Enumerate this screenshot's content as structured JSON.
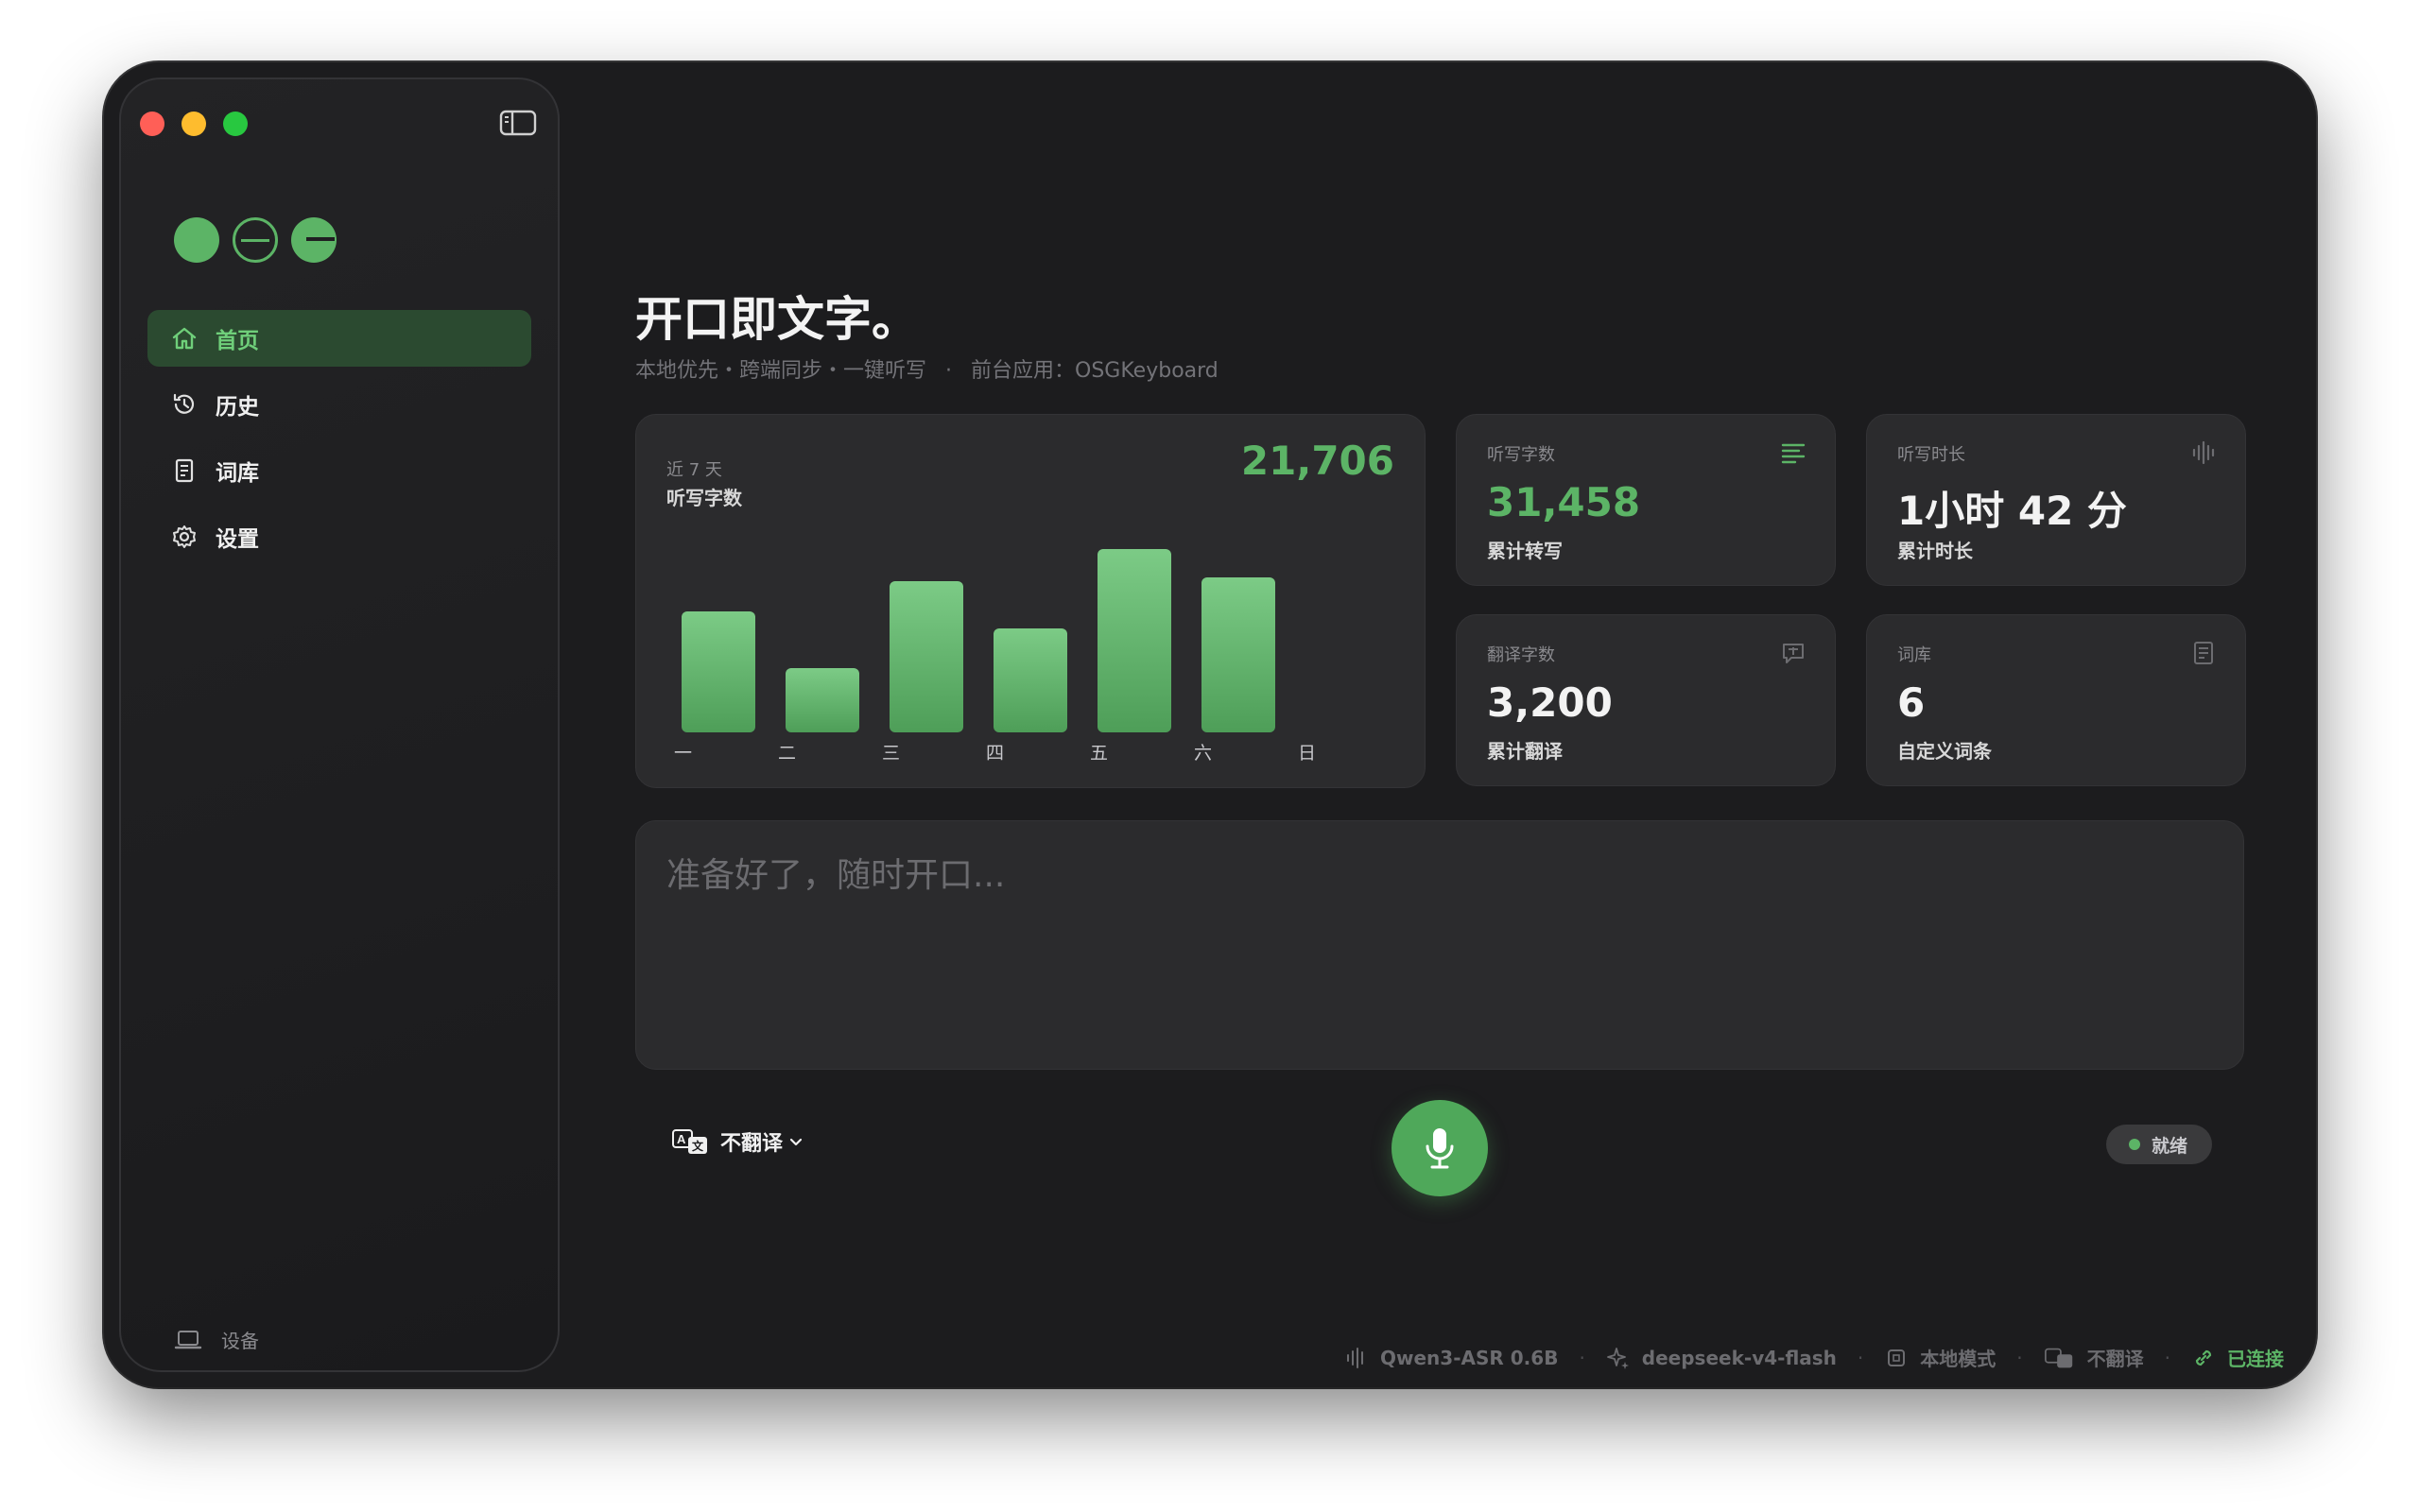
{
  "sidebar": {
    "items": [
      {
        "label": "首页",
        "icon": "home-icon",
        "active": true
      },
      {
        "label": "历史",
        "icon": "history-icon"
      },
      {
        "label": "词库",
        "icon": "book-icon"
      },
      {
        "label": "设置",
        "icon": "gear-icon"
      }
    ],
    "device_label": "设备"
  },
  "header": {
    "title": "开口即文字。",
    "tagline": "本地优先・跨端同步・一键听写",
    "separator": "·",
    "foreground_app": "前台应用：OSGKeyboard"
  },
  "weekly": {
    "period": "近 7 天",
    "label": "听写字数",
    "total": "21,706"
  },
  "chart_data": {
    "type": "bar",
    "categories": [
      "一",
      "二",
      "三",
      "四",
      "五",
      "六",
      "日"
    ],
    "values": [
      3200,
      1700,
      4000,
      2750,
      4850,
      4100,
      0
    ],
    "ylim": [
      0,
      5000
    ],
    "grid": false,
    "color": "#6cc078"
  },
  "stats": {
    "dictation_chars": {
      "label": "听写字数",
      "value": "31,458",
      "note": "累计转写",
      "icon": "text-lines-icon"
    },
    "dictation_time": {
      "label": "听写时长",
      "value": "1小时 42 分",
      "note": "累计时长",
      "icon": "waveform-icon"
    },
    "translate_chars": {
      "label": "翻译字数",
      "value": "3,200",
      "note": "累计翻译",
      "icon": "translate-bubble-icon"
    },
    "dictionary": {
      "label": "词库",
      "value": "6",
      "note": "自定义词条",
      "icon": "book-icon"
    }
  },
  "input": {
    "placeholder": "准备好了，随时开口..."
  },
  "controls": {
    "translate_mode": "不翻译",
    "status": "就绪"
  },
  "footer": {
    "asr_model": "Qwen3-ASR 0.6B",
    "llm_model": "deepseek-v4-flash",
    "mode": "本地模式",
    "translate": "不翻译",
    "connection": "已连接",
    "sep": "·"
  },
  "colors": {
    "accent": "#5cb466",
    "background": "#1c1c1e",
    "card": "#2b2b2d"
  }
}
